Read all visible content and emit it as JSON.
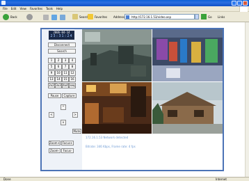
{
  "browser": {
    "menu": [
      "File",
      "Edit",
      "View",
      "Favorites",
      "Tools",
      "Help"
    ],
    "toolbar": {
      "back_label": "Back",
      "search_label": "Search",
      "favorites_label": "Favorites",
      "address_label": "Address",
      "address_value": "http://172.16.1.53/video.asp",
      "go_label": "Go",
      "links_label": "Links"
    },
    "status": {
      "left": "Done",
      "right": "Internet"
    }
  },
  "dvr": {
    "date": "2006-04-14",
    "time": "23:31:24",
    "disconnect_label": "Disconnect",
    "search_label": "Search",
    "channels": [
      "1",
      "2",
      "3",
      "4",
      "5",
      "6",
      "7",
      "8",
      "9",
      "10",
      "11",
      "12",
      "13",
      "14",
      "15",
      "16"
    ],
    "split_labels": [
      "2x2",
      "3x3",
      "4x4",
      "seq"
    ],
    "pause_label": "Pause",
    "capture_label": "Capture",
    "ptz": {
      "up": "^",
      "left": "<",
      "right": ">",
      "down": "v"
    },
    "mute_label": "Mute",
    "zoom_plus_label": "Zoom+",
    "focus_plus_label": "Focus+",
    "zoom_minus_label": "Zoom-",
    "focus_minus_label": "Focus-",
    "status_line1": "172.16.1.53 Network detected",
    "status_line2": "Bitrate: 346 Kbps, Frame rate: 4 fps"
  },
  "colors": {
    "frame_border": "#4b73b6",
    "status_text": "#6f9bd4",
    "clock_bg": "#1b2a48"
  }
}
